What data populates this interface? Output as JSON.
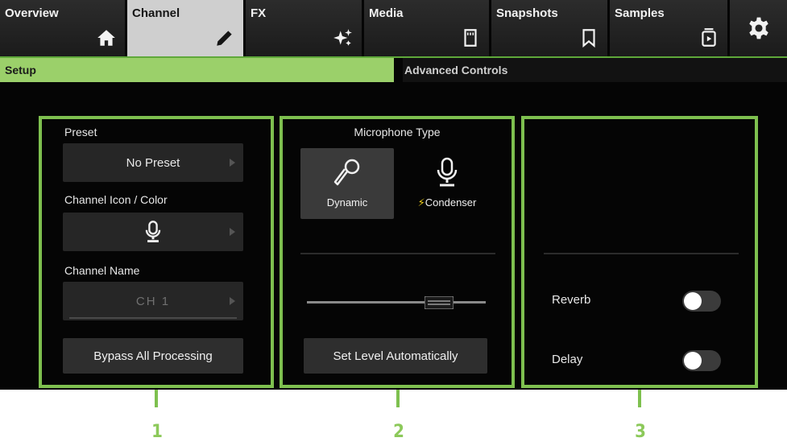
{
  "tabs": [
    {
      "label": "Overview",
      "icon": "home-icon",
      "active": false
    },
    {
      "label": "Channel",
      "icon": "pencil-icon",
      "active": true
    },
    {
      "label": "FX",
      "icon": "sparkle-icon",
      "active": false
    },
    {
      "label": "Media",
      "icon": "sd-card-icon",
      "active": false
    },
    {
      "label": "Snapshots",
      "icon": "bookmark-icon",
      "active": false
    },
    {
      "label": "Samples",
      "icon": "sample-player-icon",
      "active": false
    },
    {
      "label": "",
      "icon": "gear-icon",
      "active": false
    }
  ],
  "subtabs": {
    "setup": "Setup",
    "advanced": "Advanced Controls"
  },
  "panel1": {
    "preset_label": "Preset",
    "preset_value": "No Preset",
    "icon_color_label": "Channel Icon / Color",
    "name_label": "Channel Name",
    "name_value": "CH 1",
    "bypass_label": "Bypass All Processing"
  },
  "panel2": {
    "mic_type_label": "Microphone Type",
    "dynamic_label": "Dynamic",
    "condenser_label": "Condenser",
    "selected": "Dynamic",
    "auto_level_label": "Set Level Automatically"
  },
  "panel3": {
    "reverb_label": "Reverb",
    "delay_label": "Delay",
    "reverb_on": false,
    "delay_on": false
  },
  "callouts": [
    "1",
    "2",
    "3"
  ],
  "colors": {
    "accent_green": "#7ec04f",
    "setup_tab_green": "#9bd06a",
    "active_tab": "#cfcfcf",
    "background": "#050505",
    "condenser_bolt": "#f2d21a"
  }
}
